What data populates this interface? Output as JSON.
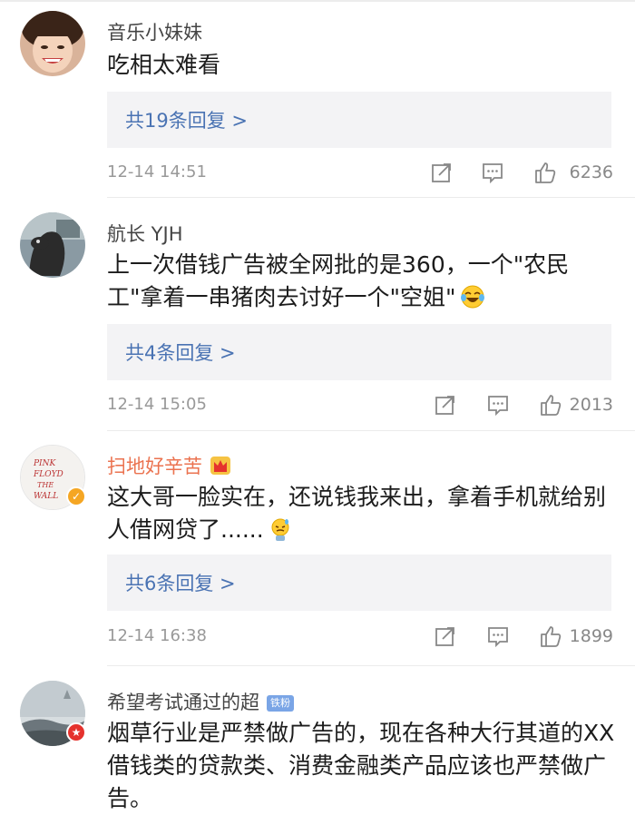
{
  "comments": [
    {
      "username": "音乐小妹妹",
      "text": "吃相太难看",
      "replies": "共19条回复 >",
      "time": "12-14 14:51",
      "likes": "6236",
      "icons": [
        "share-icon",
        "comment-icon",
        "like-icon"
      ]
    },
    {
      "username": "航长 YJH",
      "text": "上一次借钱广告被全网批的是360，一个\"农民工\"拿着一串猪肉去讨好一个\"空姐\"",
      "replies": "共4条回复 >",
      "time": "12-14 15:05",
      "likes": "2013",
      "icons": [
        "share-icon",
        "comment-icon",
        "like-icon",
        "laugh-cry-emoji"
      ]
    },
    {
      "username": "扫地好辛苦",
      "text": "这大哥一脸实在，还说钱我来出，拿着手机就给别人借网贷了......",
      "replies": "共6条回复 >",
      "time": "12-14 16:38",
      "likes": "1899",
      "avatar_text": "PINK FLOYD THE WALL",
      "badge_color": "#f5a623",
      "icons": [
        "crown-icon",
        "verified-badge",
        "share-icon",
        "comment-icon",
        "like-icon",
        "sweat-emoji"
      ]
    },
    {
      "username": "希望考试通过的超",
      "fan_badge": "铁粉",
      "text": "烟草行业是严禁做广告的，现在各种大行其道的XX借钱类的贷款类、消费金融类产品应该也严禁做广告。",
      "badge_color": "#e5322d",
      "icons": [
        "star-badge"
      ]
    }
  ],
  "colors": {
    "reply_link": "#4a73b3",
    "vip_name": "#eb7350",
    "reply_bg": "#f3f3f5"
  }
}
